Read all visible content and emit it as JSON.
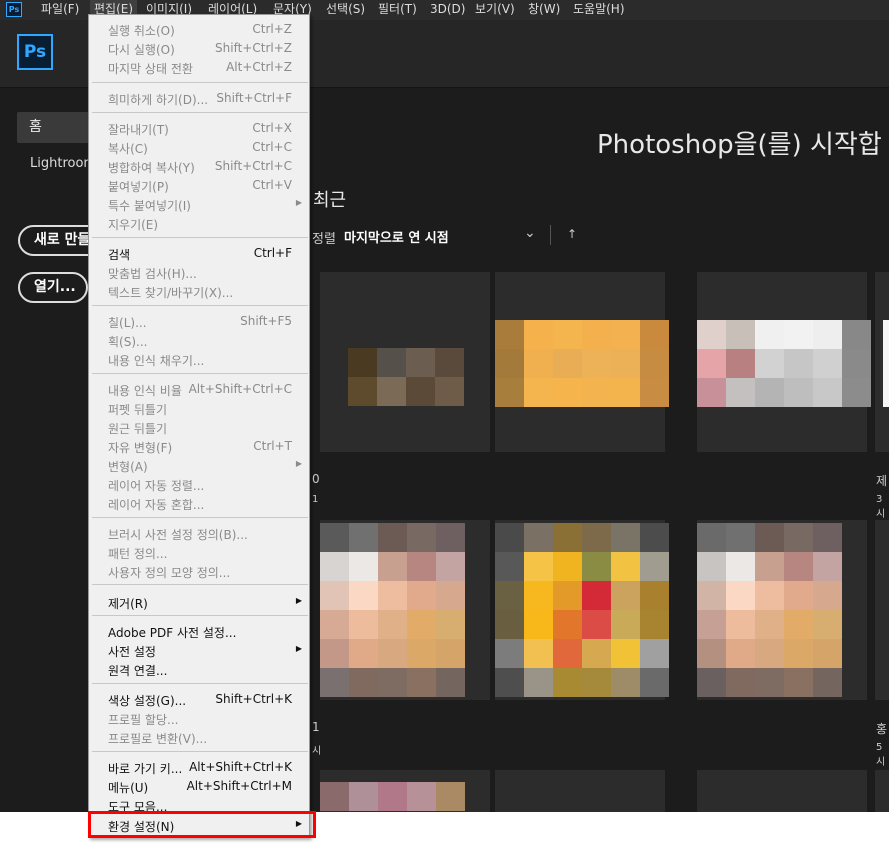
{
  "menubar": {
    "logo": "Ps",
    "items": [
      "파일(F)",
      "편집(E)",
      "이미지(I)",
      "레이어(L)",
      "문자(Y)",
      "선택(S)",
      "필터(T)",
      "3D(D)",
      "보기(V)",
      "창(W)",
      "도움말(H)"
    ]
  },
  "app": {
    "logo": "Ps",
    "sidebar": {
      "home": "홈",
      "lightroom": "Lightroom"
    },
    "buttons": {
      "new": "새로 만들기...",
      "open": "열기..."
    },
    "welcome_title": "Photoshop을(를) 시작합",
    "recent_title": "최근",
    "sort_label": "정렬",
    "sort_value": "마지막으로 연 시점",
    "sort_chevron": "⌄",
    "sort_arrow": "↑",
    "peek": {
      "r1c0": "0",
      "r1c0b": "1",
      "r1c3": "제",
      "r1c3b": "3시",
      "r2c0": "1",
      "r2c0b": "시",
      "r2c3": "홍",
      "r2c3b": "5시"
    }
  },
  "edit_menu": {
    "items": [
      {
        "label": "실행 취소(O)",
        "shortcut": "Ctrl+Z",
        "state": "disabled"
      },
      {
        "label": "다시 실행(O)",
        "shortcut": "Shift+Ctrl+Z",
        "state": "disabled"
      },
      {
        "label": "마지막 상태 전환",
        "shortcut": "Alt+Ctrl+Z",
        "state": "disabled"
      },
      {
        "label": "희미하게 하기(D)...",
        "shortcut": "Shift+Ctrl+F",
        "state": "disabled"
      },
      {
        "label": "잘라내기(T)",
        "shortcut": "Ctrl+X",
        "state": "disabled"
      },
      {
        "label": "복사(C)",
        "shortcut": "Ctrl+C",
        "state": "disabled"
      },
      {
        "label": "병합하여 복사(Y)",
        "shortcut": "Shift+Ctrl+C",
        "state": "disabled"
      },
      {
        "label": "붙여넣기(P)",
        "shortcut": "Ctrl+V",
        "state": "disabled"
      },
      {
        "label": "특수 붙여넣기(I)",
        "shortcut": "",
        "state": "disabled",
        "submenu": true
      },
      {
        "label": "지우기(E)",
        "shortcut": "",
        "state": "disabled"
      },
      {
        "label": "검색",
        "shortcut": "Ctrl+F",
        "state": "enabled"
      },
      {
        "label": "맞춤법 검사(H)...",
        "shortcut": "",
        "state": "disabled"
      },
      {
        "label": "텍스트 찾기/바꾸기(X)...",
        "shortcut": "",
        "state": "disabled"
      },
      {
        "label": "칠(L)...",
        "shortcut": "Shift+F5",
        "state": "disabled"
      },
      {
        "label": "획(S)...",
        "shortcut": "",
        "state": "disabled"
      },
      {
        "label": "내용 인식 채우기...",
        "shortcut": "",
        "state": "disabled"
      },
      {
        "label": "내용 인식 비율",
        "shortcut": "Alt+Shift+Ctrl+C",
        "state": "disabled"
      },
      {
        "label": "퍼펫 뒤틀기",
        "shortcut": "",
        "state": "disabled"
      },
      {
        "label": "원근 뒤틀기",
        "shortcut": "",
        "state": "disabled"
      },
      {
        "label": "자유 변형(F)",
        "shortcut": "Ctrl+T",
        "state": "disabled"
      },
      {
        "label": "변형(A)",
        "shortcut": "",
        "state": "disabled",
        "submenu": true
      },
      {
        "label": "레이어 자동 정렬...",
        "shortcut": "",
        "state": "disabled"
      },
      {
        "label": "레이어 자동 혼합...",
        "shortcut": "",
        "state": "disabled"
      },
      {
        "label": "브러시 사전 설정 정의(B)...",
        "shortcut": "",
        "state": "disabled"
      },
      {
        "label": "패턴 정의...",
        "shortcut": "",
        "state": "disabled"
      },
      {
        "label": "사용자 정의 모양 정의...",
        "shortcut": "",
        "state": "disabled"
      },
      {
        "label": "제거(R)",
        "shortcut": "",
        "state": "enabled",
        "submenu": true
      },
      {
        "label": "Adobe PDF 사전 설정...",
        "shortcut": "",
        "state": "enabled"
      },
      {
        "label": "사전 설정",
        "shortcut": "",
        "state": "enabled",
        "submenu": true
      },
      {
        "label": "원격 연결...",
        "shortcut": "",
        "state": "enabled"
      },
      {
        "label": "색상 설정(G)...",
        "shortcut": "Shift+Ctrl+K",
        "state": "enabled"
      },
      {
        "label": "프로필 할당...",
        "shortcut": "",
        "state": "disabled"
      },
      {
        "label": "프로필로 변환(V)...",
        "shortcut": "",
        "state": "disabled"
      },
      {
        "label": "바로 가기 키...",
        "shortcut": "Alt+Shift+Ctrl+K",
        "state": "enabled"
      },
      {
        "label": "메뉴(U)",
        "shortcut": "Alt+Shift+Ctrl+M",
        "state": "enabled"
      },
      {
        "label": "도구 모음...",
        "shortcut": "",
        "state": "enabled"
      },
      {
        "label": "환경 설정(N)",
        "shortcut": "",
        "state": "enabled",
        "submenu": true
      }
    ]
  },
  "colors": {
    "accent": "#31a8ff",
    "highlight": "#ff0000",
    "menu_bg": "#f0f0f0",
    "app_bg": "#1c1c1c"
  }
}
